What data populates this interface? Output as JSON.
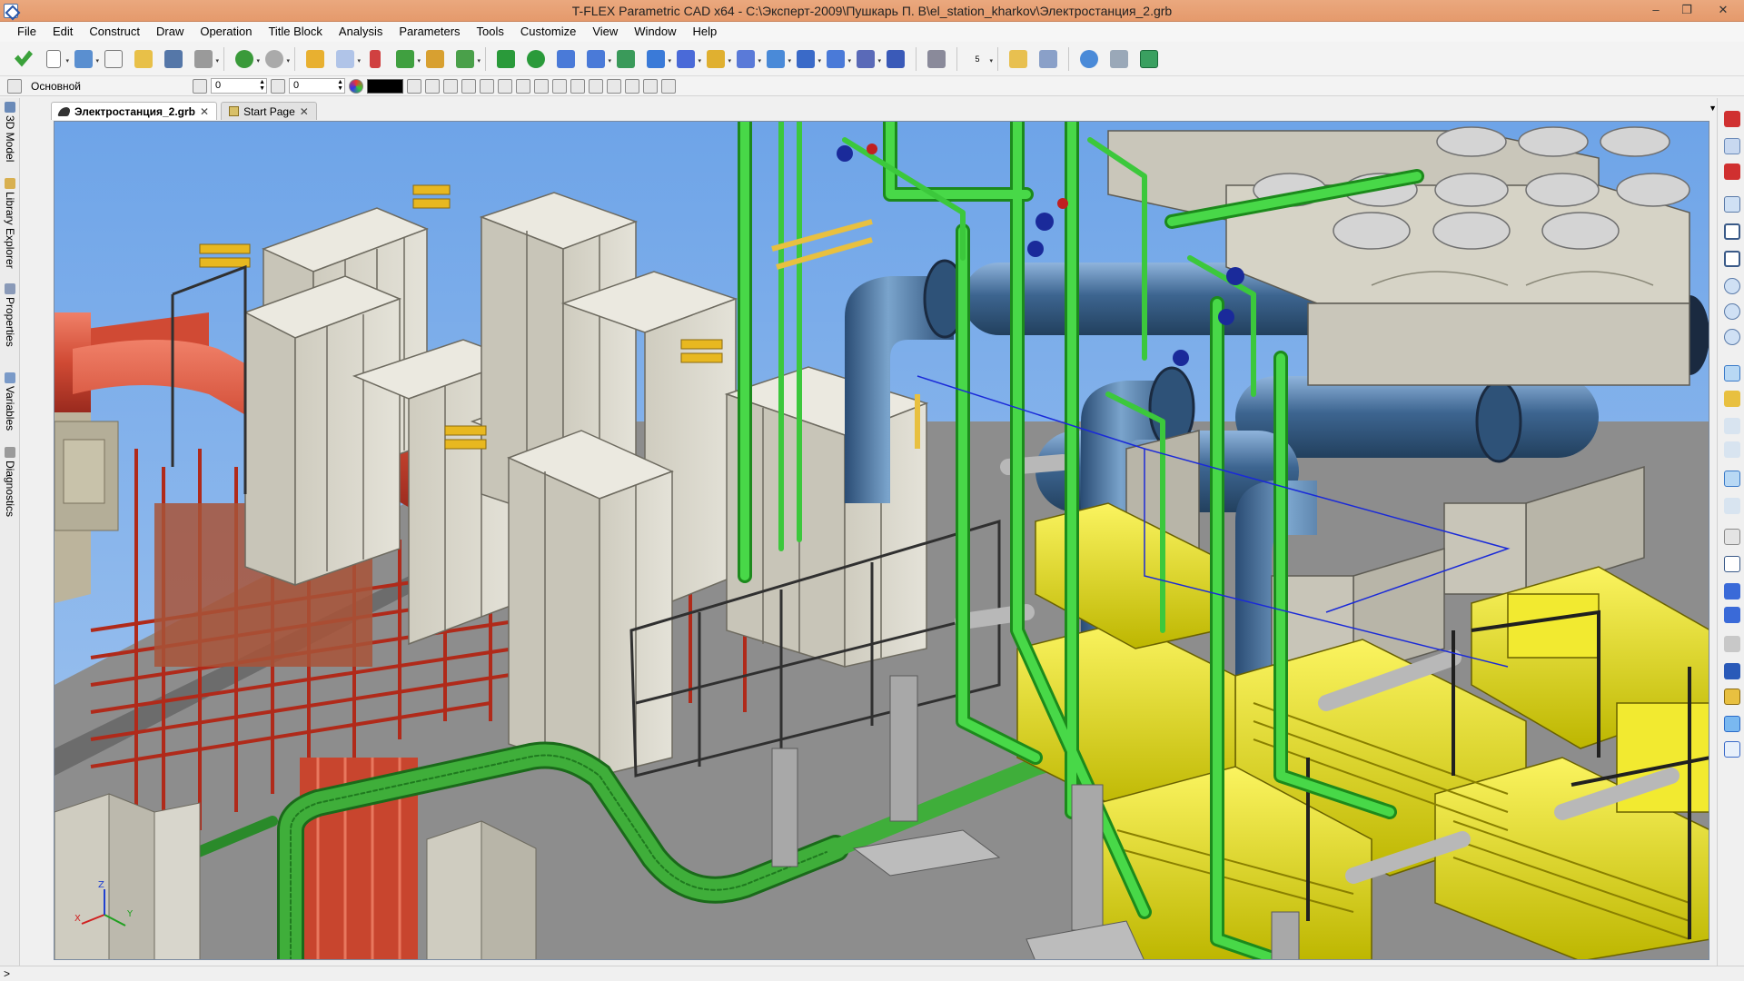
{
  "window": {
    "title": "T-FLEX Parametric CAD x64 - C:\\Эксперт-2009\\Пушкарь П. В\\el_station_kharkov\\Электростанция_2.grb",
    "minimize": "–",
    "maximize": "❐",
    "close": "✕"
  },
  "menu": [
    "File",
    "Edit",
    "Construct",
    "Draw",
    "Operation",
    "Title Block",
    "Analysis",
    "Parameters",
    "Tools",
    "Customize",
    "View",
    "Window",
    "Help"
  ],
  "toolbar2": {
    "layer": "Основной",
    "level_value": "0",
    "priority_value": "0"
  },
  "tabs": [
    {
      "label": "Электростанция_2.grb",
      "active": true
    },
    {
      "label": "Start Page",
      "active": false
    }
  ],
  "tab_close": "✕",
  "tab_menu": "▼",
  "left_panel": [
    "3D Model",
    "Library Explorer",
    "Properties",
    "Variables",
    "Diagnostics"
  ],
  "toolbar_zoom_value": "5",
  "triad": {
    "x": "X",
    "y": "Y",
    "z": "Z"
  },
  "status": ">",
  "colors": {
    "titlebar": "#e59a6c",
    "viewport_sky": "#8fb8ec",
    "floor": "#8c8c8c",
    "cabinet": "#d8d5c8",
    "red_pipe": "#d8503a",
    "green_pipe": "#3ec93e",
    "blue_pipe": "#4a6f98",
    "yellow_engine": "#e8e020"
  }
}
